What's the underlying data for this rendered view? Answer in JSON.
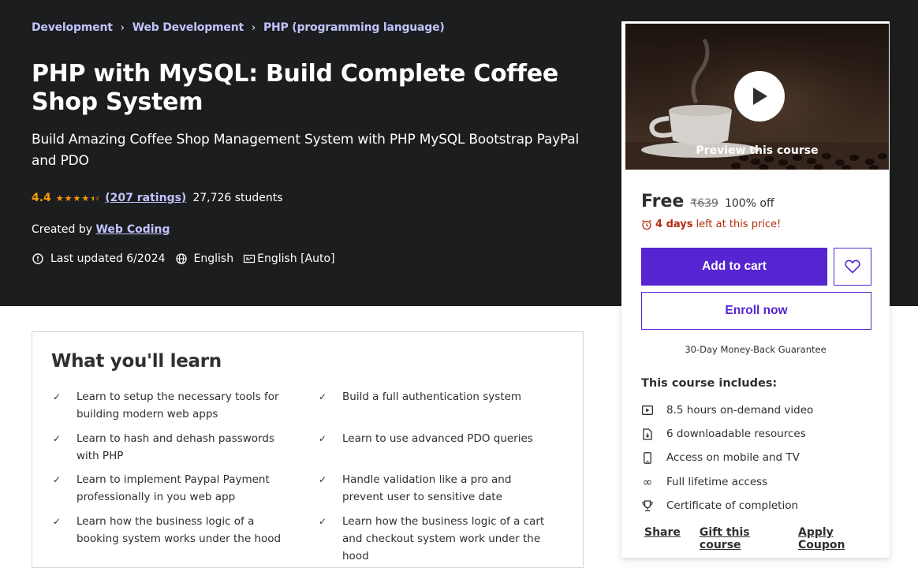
{
  "breadcrumb": [
    "Development",
    "Web Development",
    "PHP (programming language)"
  ],
  "course": {
    "title": "PHP with MySQL: Build Complete Coffee Shop System",
    "subtitle": "Build Amazing Coffee Shop Management System with PHP MySQL Bootstrap PayPal and PDO",
    "rating": "4.4",
    "stars_value": 4.4,
    "ratings_count": "(207 ratings)",
    "students": "27,726 students",
    "created_by_label": "Created by",
    "instructor": "Web Coding",
    "last_updated": "Last updated 6/2024",
    "language": "English",
    "captions": "English [Auto]"
  },
  "learn": {
    "heading": "What you'll learn",
    "items": [
      "Learn to setup the necessary tools for building modern web apps",
      "Build a full authentication system",
      "Learn to hash and dehash passwords with PHP",
      "Learn to use advanced PDO queries",
      "Learn to implement Paypal Payment professionally in you web app",
      "Handle validation like a pro and prevent user to sensitive date",
      "Learn how the business logic of a booking system works under the hood",
      "Learn how the business logic of a cart and checkout system work under the hood"
    ]
  },
  "sidebar": {
    "preview_label": "Preview this course",
    "price": "Free",
    "old_price": "₹639",
    "discount": "100% off",
    "timer_days": "4 days",
    "timer_rest": "left at this price!",
    "add_to_cart": "Add to cart",
    "enroll": "Enroll now",
    "guarantee": "30-Day Money-Back Guarantee",
    "includes_title": "This course includes:",
    "includes": [
      {
        "icon": "video-icon",
        "label": "8.5 hours on-demand video"
      },
      {
        "icon": "file-download-icon",
        "label": "6 downloadable resources"
      },
      {
        "icon": "mobile-icon",
        "label": "Access on mobile and TV"
      },
      {
        "icon": "infinity-icon",
        "label": "Full lifetime access"
      },
      {
        "icon": "trophy-icon",
        "label": "Certificate of completion"
      }
    ],
    "links": [
      "Share",
      "Gift this course",
      "Apply Coupon"
    ]
  },
  "colors": {
    "hero_bg": "#1c1d1f",
    "accent": "#5624d0",
    "link_light": "#c0c4fc",
    "star": "#f69c08",
    "timer": "#b32d0f"
  }
}
